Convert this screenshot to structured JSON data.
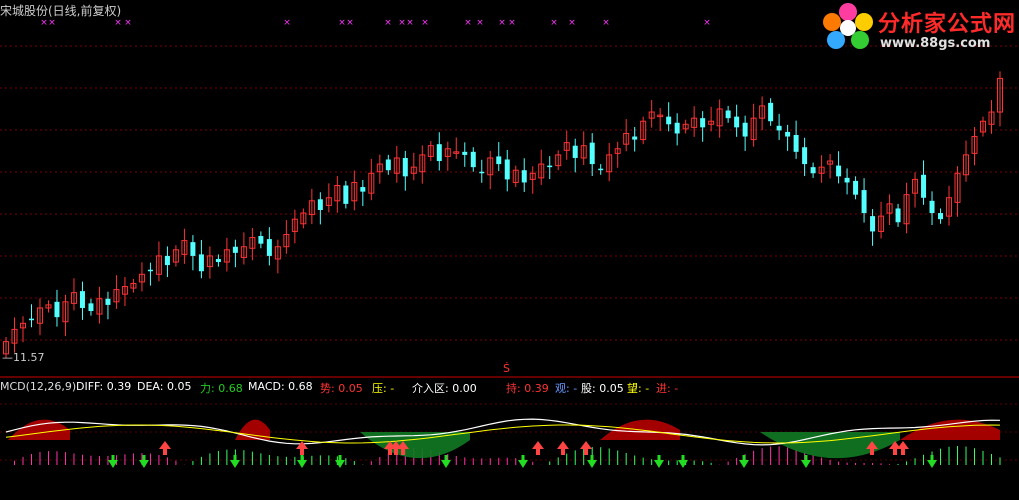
{
  "header": {
    "title": "宋城股份(日线,前复权)",
    "min_price_label": "11.57",
    "marker": "Ś"
  },
  "logo": {
    "name": "分析家公式网",
    "url": "www.88gs.com"
  },
  "indicator_bar": [
    {
      "label": "MCD(12,26,9)",
      "color": "#dddddd"
    },
    {
      "label": "DIFF: 0.39",
      "color": "#ffffff"
    },
    {
      "label": "DEA: 0.05",
      "color": "#ffffff"
    },
    {
      "label": "力: 0.68",
      "color": "#22cc22"
    },
    {
      "label": "MACD: 0.68",
      "color": "#ffffff"
    },
    {
      "label": "势: 0.05",
      "color": "#ff3333"
    },
    {
      "label": "压: -",
      "color": "#ffff00"
    },
    {
      "label": "介入区: 0.00",
      "color": "#ffffff"
    },
    {
      "label": "持: 0.39",
      "color": "#ff3333"
    },
    {
      "label": "观: -",
      "color": "#6699ff"
    },
    {
      "label": "股: 0.05",
      "color": "#ffffff"
    },
    {
      "label": "望: -",
      "color": "#ffff00"
    },
    {
      "label": "进: -",
      "color": "#ff3333"
    }
  ],
  "colors": {
    "up": "#ff3333",
    "down": "#54ffff",
    "grid": "#7a0000",
    "cross": "#ff33ff"
  },
  "chart_data": {
    "type": "candlestick",
    "title": "宋城股份(日线,前复权)",
    "min_label": 11.57,
    "ylim": [
      11.2,
      21.0
    ],
    "close": [
      11.8,
      12.2,
      12.4,
      12.5,
      12.9,
      13.0,
      12.6,
      13.1,
      13.4,
      12.9,
      12.8,
      13.2,
      13.0,
      13.5,
      13.6,
      13.7,
      14.0,
      14.1,
      14.6,
      14.3,
      14.8,
      15.1,
      14.6,
      14.1,
      14.6,
      14.4,
      14.8,
      14.7,
      14.9,
      15.2,
      15.0,
      14.6,
      14.9,
      15.3,
      15.8,
      16.0,
      16.4,
      16.1,
      16.5,
      16.9,
      16.3,
      17.0,
      16.7,
      17.3,
      17.6,
      17.4,
      17.8,
      17.2,
      17.5,
      17.9,
      18.2,
      17.7,
      18.1,
      18.0,
      17.9,
      17.5,
      17.3,
      17.8,
      17.6,
      17.1,
      17.4,
      17.0,
      17.3,
      17.6,
      17.5,
      17.9,
      18.3,
      17.8,
      18.2,
      17.6,
      17.4,
      17.9,
      18.1,
      18.6,
      18.4,
      19.0,
      19.3,
      19.2,
      18.9,
      18.6,
      18.9,
      19.1,
      18.8,
      19.0,
      19.4,
      19.1,
      18.8,
      18.5,
      19.1,
      19.5,
      19.0,
      18.7,
      18.5,
      18.0,
      17.6,
      17.3,
      17.5,
      17.7,
      17.2,
      17.0,
      16.6,
      16.0,
      15.4,
      15.9,
      16.3,
      15.7,
      16.6,
      17.1,
      16.5,
      16.0,
      15.8,
      16.5,
      17.3,
      17.9,
      18.5,
      19.0,
      19.3,
      20.4
    ],
    "markers": {
      "cross_count": 16,
      "buy_arrows": 13,
      "sell_arrows": 10
    },
    "indicator": {
      "name": "MCD(12,26,9)",
      "DIFF": 0.39,
      "DEA": 0.05,
      "MACD": 0.68
    }
  }
}
